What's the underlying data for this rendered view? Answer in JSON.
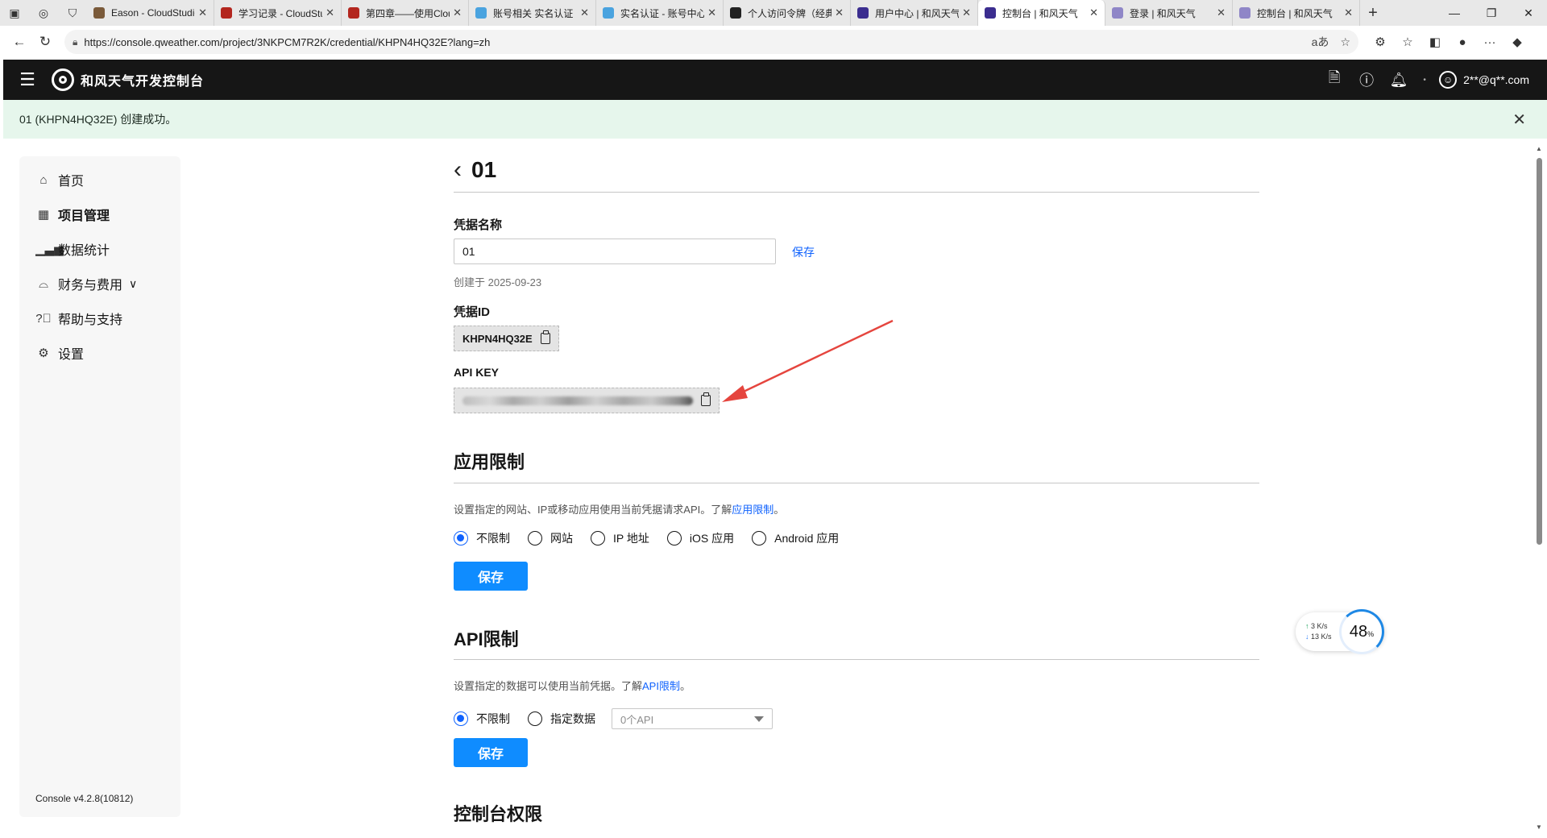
{
  "browser": {
    "tabs": [
      {
        "title": "Eason - CloudStudio",
        "color": "#7a5a3a"
      },
      {
        "title": "学习记录 - CloudStudio",
        "color": "#b3261e"
      },
      {
        "title": "第四章——使用CloudStudio",
        "color": "#b3261e"
      },
      {
        "title": "账号相关 实名认证",
        "color": "#4aa3df"
      },
      {
        "title": "实名认证 - 账号中心",
        "color": "#4aa3df"
      },
      {
        "title": "个人访问令牌（经典）",
        "color": "#222222"
      },
      {
        "title": "用户中心 | 和风天气",
        "color": "#3b2d8f"
      },
      {
        "title": "控制台 | 和风天气",
        "color": "#3b2d8f"
      },
      {
        "title": "登录 | 和风天气",
        "color": "#8f86c7"
      },
      {
        "title": "控制台 | 和风天气",
        "color": "#8f86c7"
      }
    ],
    "active_tab_index": 7,
    "url": "https://console.qweather.com/project/3NKPCM7R2K/credential/KHPN4HQ32E?lang=zh"
  },
  "header": {
    "brand": "和风天气开发控制台",
    "user": "2**@q**.com"
  },
  "banner": {
    "message": "01 (KHPN4HQ32E) 创建成功。"
  },
  "sidebar": {
    "items": [
      {
        "label": "首页",
        "icon": "home-icon"
      },
      {
        "label": "项目管理",
        "icon": "grid-icon"
      },
      {
        "label": "数据统计",
        "icon": "chart-icon"
      },
      {
        "label": "财务与费用",
        "icon": "wallet-icon"
      },
      {
        "label": "帮助与支持",
        "icon": "help-icon"
      },
      {
        "label": "设置",
        "icon": "gear-icon"
      }
    ],
    "active_index": 1,
    "version": "Console v4.2.8(10812)"
  },
  "credential": {
    "title": "01",
    "name_label": "凭据名称",
    "name_value": "01",
    "save_link": "保存",
    "created": "创建于 2025-09-23",
    "id_label": "凭据ID",
    "id_value": "KHPN4HQ32E",
    "apikey_label": "API KEY"
  },
  "app_restriction": {
    "title": "应用限制",
    "desc_prefix": "设置指定的网站、IP或移动应用使用当前凭据请求API。了解",
    "desc_link": "应用限制",
    "desc_suffix": "。",
    "options": [
      "不限制",
      "网站",
      "IP 地址",
      "iOS 应用",
      "Android 应用"
    ],
    "selected": 0,
    "button": "保存"
  },
  "api_restriction": {
    "title": "API限制",
    "desc_prefix": "设置指定的数据可以使用当前凭据。了解",
    "desc_link": "API限制",
    "desc_suffix": "。",
    "options": [
      "不限制",
      "指定数据"
    ],
    "selected": 0,
    "select_placeholder": "0个API",
    "button": "保存"
  },
  "console_permission": {
    "title": "控制台权限"
  },
  "net_monitor": {
    "up": "3",
    "down": "13",
    "unit": "K/s",
    "percent": "48",
    "percent_unit": "%"
  },
  "colors": {
    "accent": "#0f62fe",
    "button": "#0f8cff",
    "banner_bg": "#e6f6ec",
    "header_bg": "#161616",
    "arrow": "#e5453e"
  }
}
